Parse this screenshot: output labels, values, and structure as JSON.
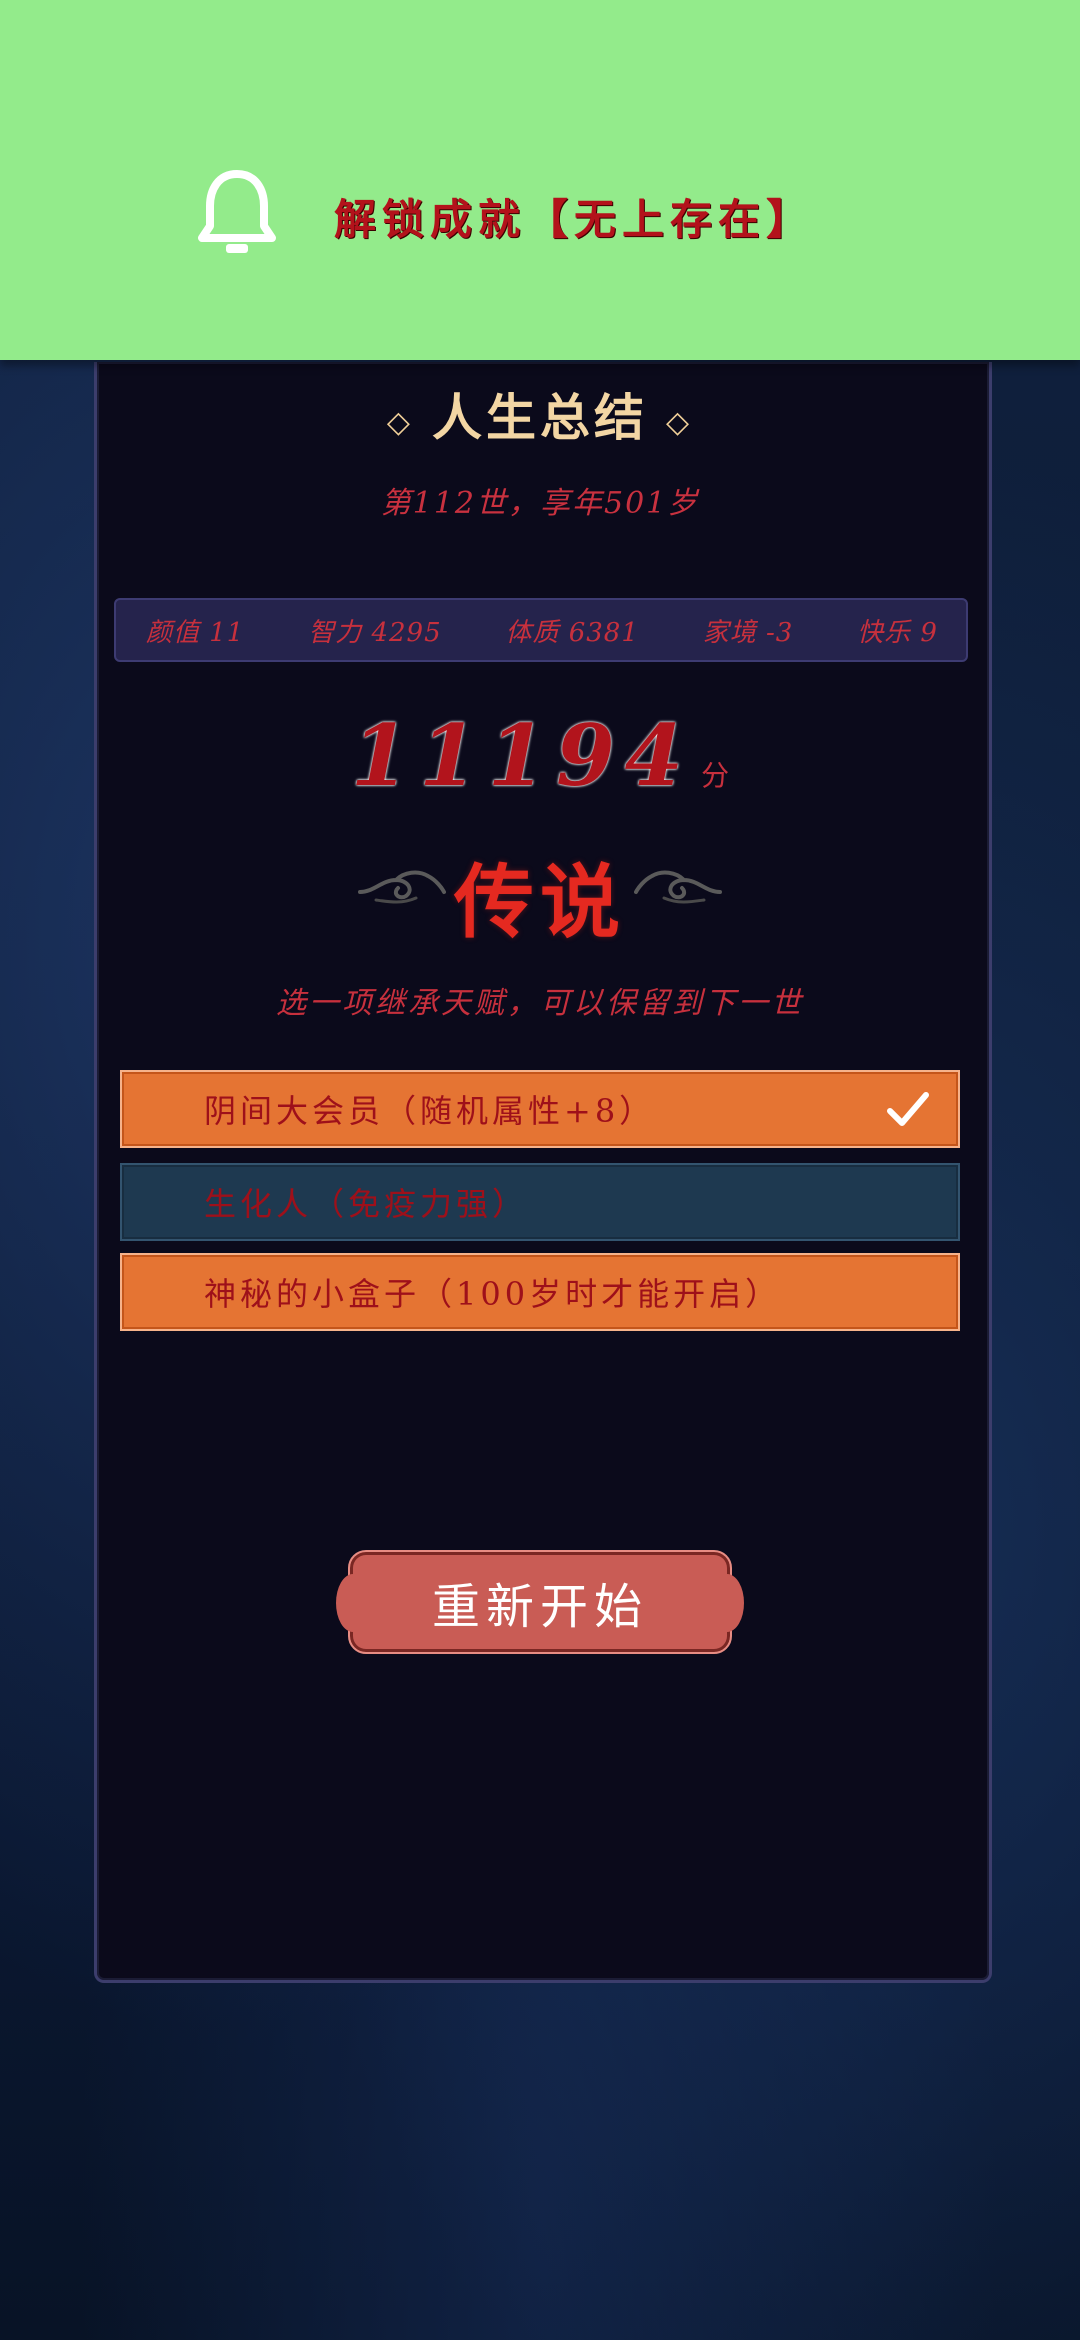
{
  "notification": {
    "icon": "bell-icon",
    "text": "解锁成就【无上存在】"
  },
  "summary": {
    "title": "人生总结",
    "subtitle": "第112世，享年501岁"
  },
  "stats": [
    {
      "label": "颜值",
      "value": "11",
      "text": "颜值 11"
    },
    {
      "label": "智力",
      "value": "4295",
      "text": "智力 4295"
    },
    {
      "label": "体质",
      "value": "6381",
      "text": "体质 6381"
    },
    {
      "label": "家境",
      "value": "-3",
      "text": "家境 -3"
    },
    {
      "label": "快乐",
      "value": "9",
      "text": "快乐 9"
    }
  ],
  "score": {
    "value": "11194",
    "unit": "分"
  },
  "rank": "传说",
  "hint": "选一项继承天赋，可以保留到下一世",
  "talents": [
    {
      "label": "阴间大会员（随机属性+8）",
      "selected": true
    },
    {
      "label": "生化人（免疫力强）",
      "selected": false
    },
    {
      "label": "神秘的小盒子（100岁时才能开启）",
      "selected": false
    }
  ],
  "restart_label": "重新开始",
  "colors": {
    "banner": "#93eb8b",
    "accent_red": "#c7303d",
    "option_orange": "#e57433",
    "option_blue": "#1e3950",
    "restart": "#c95c55"
  }
}
